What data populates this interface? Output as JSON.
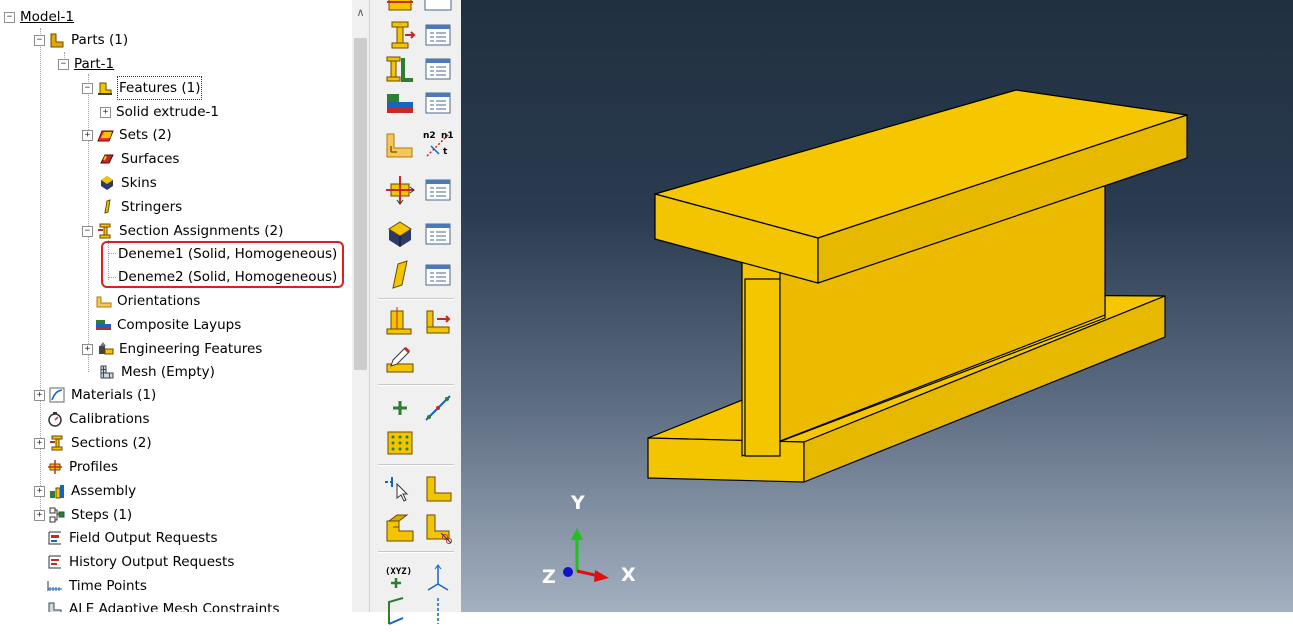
{
  "tree": {
    "model": "Model-1",
    "parts": "Parts (1)",
    "part1": "Part-1",
    "features": "Features (1)",
    "solid_extrude": "Solid extrude-1",
    "sets": "Sets (2)",
    "surfaces": "Surfaces",
    "skins": "Skins",
    "stringers": "Stringers",
    "section_assignments": "Section Assignments (2)",
    "deneme1": "Deneme1 (Solid, Homogeneous)",
    "deneme2": "Deneme2 (Solid, Homogeneous)",
    "orientations": "Orientations",
    "composite_layups": "Composite Layups",
    "engineering_features": "Engineering Features",
    "mesh": "Mesh (Empty)",
    "materials": "Materials (1)",
    "calibrations": "Calibrations",
    "sections": "Sections (2)",
    "profiles": "Profiles",
    "assembly": "Assembly",
    "steps": "Steps (1)",
    "field_output": "Field Output Requests",
    "history_output": "History Output Requests",
    "time_points": "Time Points",
    "ale": "ALE Adaptive Mesh Constraints"
  },
  "triad": {
    "x": "X",
    "y": "Y",
    "z": "Z"
  },
  "toolbox": {
    "csys_label": "(XYZ)",
    "n2_label": "n2",
    "n1_label": "n1",
    "t_label": "t"
  },
  "colors": {
    "part_yellow": "#f2c500",
    "highlight_red": "#e01c24",
    "viewport_top": "#203040",
    "viewport_bottom": "#a3b0c0"
  }
}
